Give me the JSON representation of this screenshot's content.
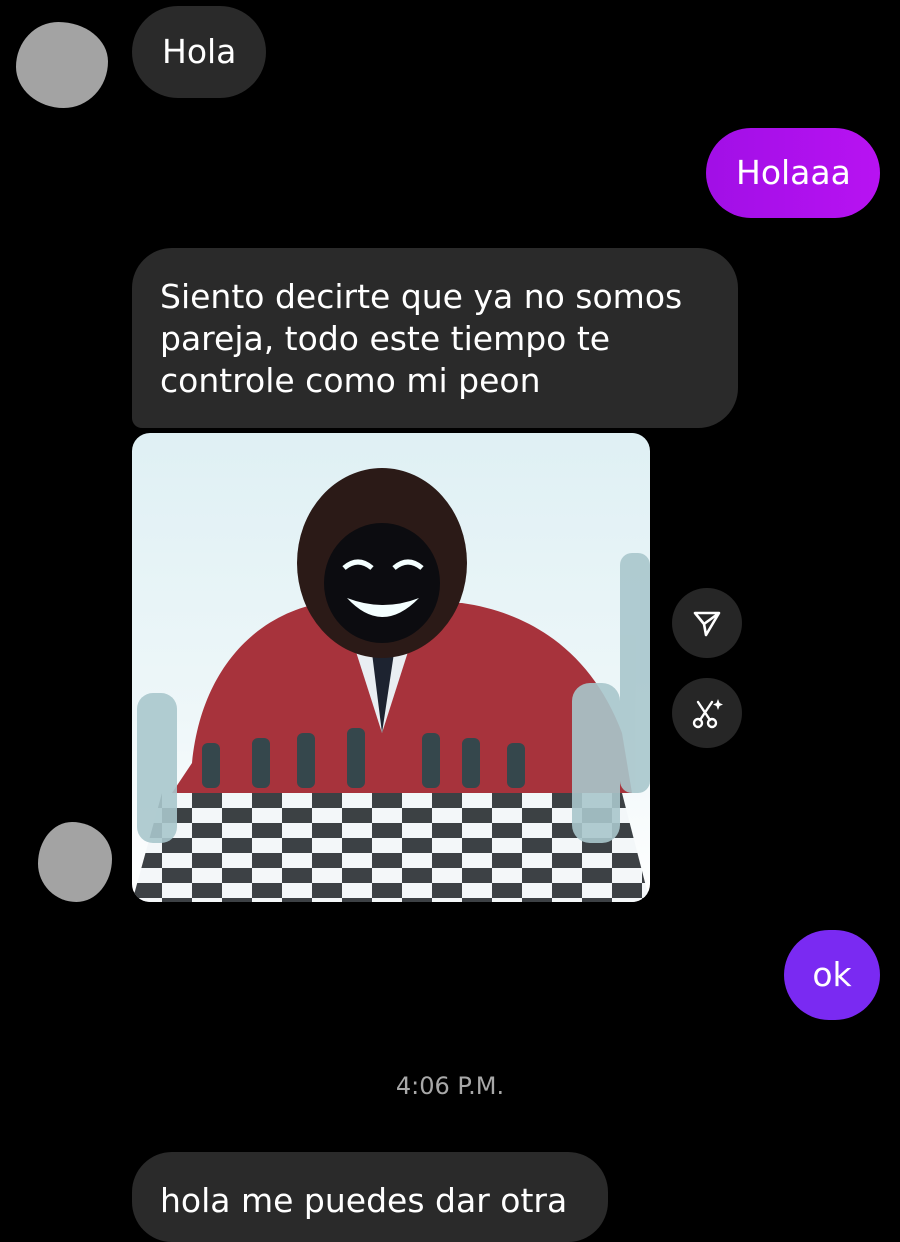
{
  "conversation": {
    "messages": [
      {
        "side": "incoming",
        "text": "Hola"
      },
      {
        "side": "outgoing",
        "text": "Holaaa"
      },
      {
        "side": "incoming",
        "text": "Siento decirte que ya no somos pareja, todo este tiempo te controle como mi peon"
      },
      {
        "side": "incoming",
        "type": "image",
        "image_desc": "anime-chess-player"
      },
      {
        "side": "outgoing",
        "text": "ok"
      },
      {
        "side": "incoming",
        "text": "hola me puedes dar otra"
      }
    ],
    "timestamp": "4:06 P.M."
  },
  "actions": {
    "share_icon": "send-icon",
    "remix_icon": "scissors-sparkle-icon"
  },
  "colors": {
    "background": "#000000",
    "incoming_bubble": "#2a2a2a",
    "outgoing_bubble_purple": "#b310f0",
    "outgoing_bubble_violet": "#7a2af2",
    "timestamp": "#a8a8a8"
  }
}
